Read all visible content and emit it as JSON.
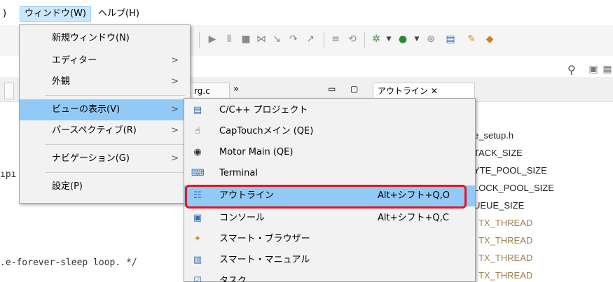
{
  "menubar": {
    "partial_left": ")",
    "window": "ウィンドウ(W)",
    "help": "ヘルプ(H)"
  },
  "window_menu": {
    "items": [
      {
        "label": "新規ウィンドウ(N)",
        "submenu": false
      },
      {
        "label": "エディター",
        "submenu": true
      },
      {
        "label": "外観",
        "submenu": true
      },
      {
        "label": "ビューの表示(V)",
        "submenu": true,
        "highlighted": true
      },
      {
        "label": "パースペクティブ(R)",
        "submenu": true
      },
      {
        "label": "ナビゲーション(G)",
        "submenu": true
      },
      {
        "label": "設定(P)",
        "submenu": false
      }
    ],
    "arrow": ">"
  },
  "view_menu": {
    "items": [
      {
        "label": "C/C++ プロジェクト",
        "shortcut": "",
        "icon": "project-icon"
      },
      {
        "label": "CapTouchメイン (QE)",
        "shortcut": "",
        "icon": "touch-icon"
      },
      {
        "label": "Motor Main (QE)",
        "shortcut": "",
        "icon": "motor-icon"
      },
      {
        "label": "Terminal",
        "shortcut": "",
        "icon": "terminal-icon"
      },
      {
        "label": "アウトライン",
        "shortcut": "Alt+シフト+Q,O",
        "icon": "outline-icon",
        "highlighted": true
      },
      {
        "label": "コンソール",
        "shortcut": "Alt+シフト+Q,C",
        "icon": "console-icon"
      },
      {
        "label": "スマート・ブラウザー",
        "shortcut": "",
        "icon": "browser-icon"
      },
      {
        "label": "スマート・マニュアル",
        "shortcut": "",
        "icon": "manual-icon"
      },
      {
        "label": "タスク",
        "shortcut": "",
        "icon": "task-icon"
      }
    ]
  },
  "tabs": {
    "editor_tab": "rg.c",
    "overflow": "»",
    "outline_tab": "アウトライン ✕"
  },
  "editor": {
    "line_partial": "ıpı",
    "comment": ".e-forever-sleep loop.  */"
  },
  "outline": {
    "lines": [
      {
        "text": "e_setup.h",
        "style": "normal"
      },
      {
        "text": "TACK_SIZE",
        "style": "normal"
      },
      {
        "text": "YTE_POOL_SIZE",
        "style": "normal"
      },
      {
        "text": "LOCK_POOL_SIZE",
        "style": "normal"
      },
      {
        "text": "UEUE_SIZE",
        "style": "normal"
      },
      {
        "text": ": TX_THREAD",
        "style": "brown"
      },
      {
        "text": ": TX_THREAD",
        "style": "brown"
      },
      {
        "text": ": TX_THREAD",
        "style": "brown"
      },
      {
        "text": ": TX_THREAD",
        "style": "brown"
      }
    ]
  },
  "colors": {
    "highlight": "#91c9f7",
    "red_box": "#e8141c",
    "menu_bg": "#f2f2f2"
  }
}
